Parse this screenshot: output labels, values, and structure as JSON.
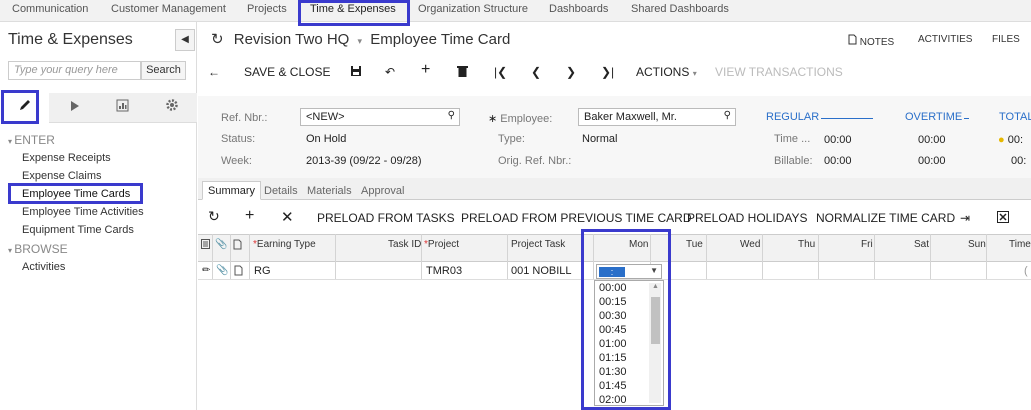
{
  "topnav": {
    "tabs": [
      "Communication",
      "Customer Management",
      "Projects",
      "Time & Expenses",
      "Organization Structure",
      "Dashboards",
      "Shared Dashboards"
    ],
    "active_index": 3
  },
  "sidebar": {
    "title": "Time & Expenses",
    "search_placeholder": "Type your query here",
    "search_button": "Search",
    "enter_label": "ENTER",
    "enter_items": [
      "Expense Receipts",
      "Expense Claims",
      "Employee Time Cards",
      "Employee Time Activities",
      "Equipment Time Cards"
    ],
    "browse_label": "BROWSE",
    "browse_items": [
      "Activities"
    ],
    "active_item": "Employee Time Cards"
  },
  "header": {
    "company": "Revision Two HQ",
    "screen": "Employee Time Card",
    "links": [
      "NOTES",
      "ACTIVITIES",
      "FILES"
    ]
  },
  "toolbar": {
    "save_close": "SAVE & CLOSE",
    "actions": "ACTIONS",
    "view_transactions": "VIEW TRANSACTIONS"
  },
  "form": {
    "ref_nbr_label": "Ref. Nbr.:",
    "ref_nbr_value": "<NEW>",
    "status_label": "Status:",
    "status_value": "On Hold",
    "week_label": "Week:",
    "week_value": "2013-39 (09/22 - 09/28)",
    "employee_label": "Employee:",
    "employee_value": "Baker Maxwell, Mr.",
    "type_label": "Type:",
    "type_value": "Normal",
    "orig_ref_label": "Orig. Ref. Nbr.:",
    "regular_head": "REGULAR",
    "overtime_head": "OVERTIME",
    "total_head": "TOTAL",
    "time_label": "Time ...",
    "billable_label": "Billable:",
    "regular_time": "00:00",
    "regular_billable": "00:00",
    "overtime_time": "00:00",
    "overtime_billable": "00:00",
    "total_time": "00:",
    "total_billable": "00:"
  },
  "form_tabs": [
    "Summary",
    "Details",
    "Materials",
    "Approval"
  ],
  "grid_toolbar": {
    "preload_tasks": "PRELOAD FROM TASKS",
    "preload_prev": "PRELOAD FROM PREVIOUS TIME CARD",
    "preload_holidays": "PRELOAD HOLIDAYS",
    "normalize": "NORMALIZE TIME CARD"
  },
  "grid": {
    "columns": [
      "Earning Type",
      "Task ID",
      "Project",
      "Project Task",
      "Mon",
      "Tue",
      "Wed",
      "Thu",
      "Fri",
      "Sat",
      "Sun",
      "Time"
    ],
    "row": {
      "earning_type": "RG",
      "task_id": "",
      "project": "TMR03",
      "project_task": "001 NOBILL",
      "time_tail": "("
    }
  },
  "dropdown": {
    "selected": ":",
    "options": [
      "00:00",
      "00:15",
      "00:30",
      "00:45",
      "01:00",
      "01:15",
      "01:30",
      "01:45",
      "02:00"
    ]
  },
  "colors": {
    "highlight": "#3a3acd",
    "accent": "#2a6fc9"
  }
}
